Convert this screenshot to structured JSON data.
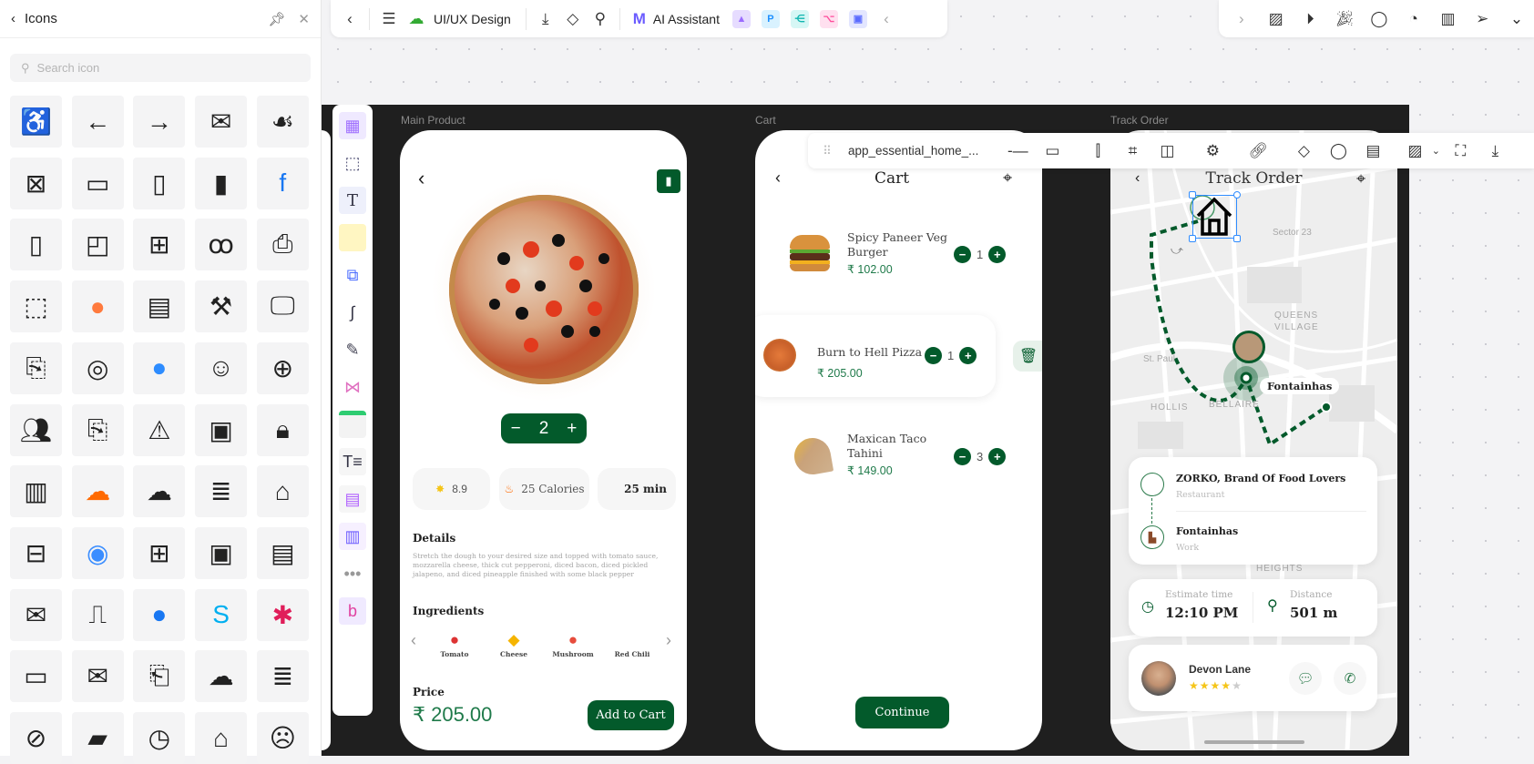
{
  "icons_panel": {
    "title": "Icons",
    "search_placeholder": "Search icon",
    "icons": [
      "accessibility",
      "arrow-left",
      "arrow-right",
      "mail",
      "hand-heart",
      "card-remove",
      "wallet",
      "phone-wifi",
      "popsicle",
      "facebook",
      "notebook",
      "app-notification",
      "window-plus",
      "cherry",
      "atm",
      "frame-select",
      "reddit",
      "banknotes",
      "tools",
      "monitor",
      "file-chart",
      "spiral",
      "messenger",
      "smile",
      "card-add",
      "users",
      "file-trend",
      "book-alert",
      "file-image",
      "lock-file",
      "money",
      "soundcloud",
      "cloud-network",
      "document",
      "home",
      "window-minus",
      "safari",
      "monitor-plus",
      "cash",
      "window-document",
      "mail-arrow",
      "chart-file",
      "facebook-circle",
      "skype",
      "slack",
      "devices",
      "mail-open",
      "save-down",
      "cloud-chat",
      "receipt",
      "file-block",
      "battery",
      "clock",
      "home-outline",
      "sleepy-face"
    ]
  },
  "top_toolbar": {
    "board_name": "UI/UX Design",
    "ai_label": "AI Assistant"
  },
  "frames": {
    "main": "Main Product",
    "cart": "Cart",
    "track": "Track Order"
  },
  "element_toolbar": {
    "element_name": "app_essential_home_..."
  },
  "product": {
    "quantity": "2",
    "rating": "8.9",
    "calories": "25 Calories",
    "time": "25 min",
    "details_title": "Details",
    "details_text": "Stretch the dough to your desired size and topped with tomato sauce, mozzarella cheese, thick cut pepperoni, diced bacon, diced pickled jalapeno, and diced pineapple finished with some black pepper",
    "ingredients_title": "Ingredients",
    "ingredients": [
      "Tomato",
      "Cheese",
      "Mushroom",
      "Red Chili"
    ],
    "price_label": "Price",
    "price": "₹ 205.00",
    "add_button": "Add to Cart"
  },
  "cart": {
    "title": "Cart",
    "items": [
      {
        "name": "Spicy Paneer Veg Burger",
        "price": "₹ 102.00",
        "qty": "1"
      },
      {
        "name": "Burn to Hell Pizza",
        "price": "₹ 205.00",
        "qty": "1"
      },
      {
        "name": "Maxican Taco Tahini",
        "price": "₹ 149.00",
        "qty": "3"
      }
    ],
    "continue": "Continue"
  },
  "track": {
    "title": "Track Order",
    "map_labels": [
      "Sector 23",
      "QUEENS",
      "VILLAGE",
      "St. Paul",
      "HOLLIS",
      "BELLAIRE",
      "HEIGHTS"
    ],
    "destination_tag": "Fontainhas",
    "from_name": "ZORKO, Brand Of Food Lovers",
    "from_type": "Restaurant",
    "to_name": "Fontainhas",
    "to_type": "Work",
    "eta_label": "Estimate time",
    "eta": "12:10 PM",
    "distance_label": "Distance",
    "distance": "501 m",
    "driver": "Devon Lane",
    "driver_rating": 4,
    "driver_rating_max": 5
  },
  "colors": {
    "brand_green": "#035a2b",
    "price_green": "#1f7a4a",
    "selection_blue": "#2f8cff",
    "frame_bg": "#1f1f1f"
  }
}
